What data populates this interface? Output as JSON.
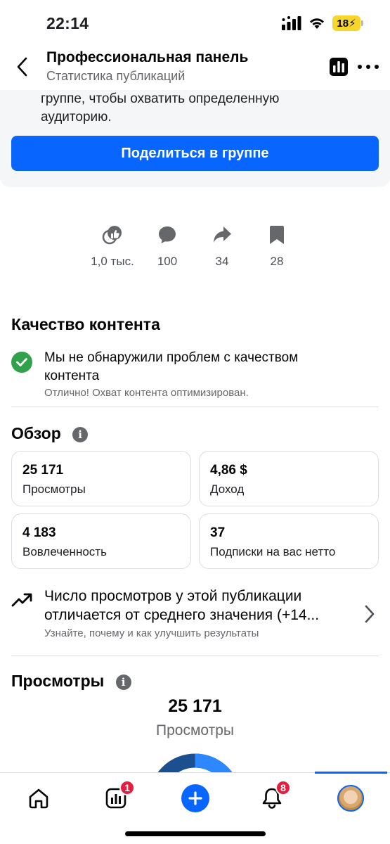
{
  "status_bar": {
    "time": "22:14",
    "battery": "18"
  },
  "header": {
    "title": "Профессиональная панель",
    "subtitle": "Статистика публикаций"
  },
  "share_card": {
    "text_line1": "группе, чтобы охватить определенную",
    "text_line2": "аудиторию.",
    "button_label": "Поделиться в группе"
  },
  "reactions": [
    {
      "icon": "reactions-icon",
      "value": "1,0 тыс."
    },
    {
      "icon": "comment-icon",
      "value": "100"
    },
    {
      "icon": "share-icon",
      "value": "34"
    },
    {
      "icon": "bookmark-icon",
      "value": "28"
    }
  ],
  "content_quality": {
    "title": "Качество контента",
    "message_line1": "Мы не обнаружили проблем с качеством",
    "message_line2": "контента",
    "subtext": "Отлично! Охват контента оптимизирован."
  },
  "overview": {
    "title": "Обзор",
    "cards": [
      {
        "value": "25 171",
        "label": "Просмотры"
      },
      {
        "value": "4,86 $",
        "label": "Доход"
      },
      {
        "value": "4 183",
        "label": "Вовлеченность"
      },
      {
        "value": "37",
        "label": "Подписки на вас нетто"
      }
    ]
  },
  "insight": {
    "line1": "Число просмотров у этой публикации",
    "line2": "отличается от среднего значения (+14...",
    "subtext": "Узнайте, почему и как улучшить результаты"
  },
  "views": {
    "title": "Просмотры",
    "total": "25 171",
    "label": "Просмотры"
  },
  "bottom_nav": {
    "insights_badge": "1",
    "notifications_badge": "8"
  },
  "colors": {
    "accent": "#0866ff",
    "success": "#31a24c",
    "badge": "#e41e3f",
    "donut_dark": "#1b4f8f",
    "donut_light": "#2d88ff"
  }
}
